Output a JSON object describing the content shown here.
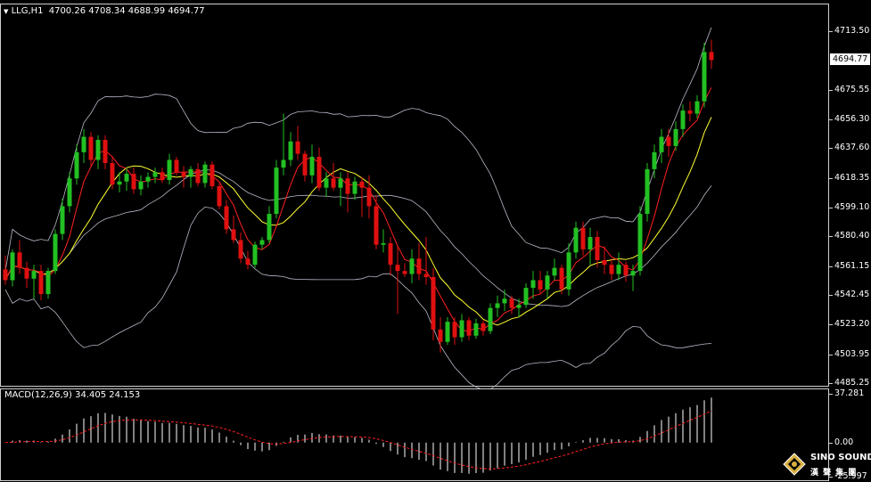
{
  "chart_header": {
    "symbol_label": "LLG,H1",
    "ohlc_text": "4700.26 4708.34 4688.99 4694.77",
    "arrow_glyph": "▼"
  },
  "macd_header": {
    "label": "MACD(12,26,9) 34.405 24.153"
  },
  "price_axis": {
    "ticks": [
      "4713.50",
      "4694.77",
      "4675.55",
      "4656.30",
      "4637.60",
      "4618.35",
      "4599.10",
      "4580.40",
      "4561.15",
      "4542.45",
      "4523.20",
      "4503.95",
      "4485.25"
    ],
    "current_price": "4694.77"
  },
  "macd_axis": {
    "ticks": [
      "37.281",
      "0.00",
      "-25.997"
    ]
  },
  "logo": {
    "text_en": "SINO SOUND",
    "text_cn": "漢 聲 集 團"
  },
  "colors": {
    "background": "#000000",
    "bull_candle": "#22c022",
    "bear_candle": "#e01010",
    "bollinger": "#b8b8c8",
    "ma_fast": "#ff2020",
    "ma_slow": "#ffff30",
    "macd_hist": "#ffffff",
    "macd_signal": "#ff2020"
  },
  "chart_data": [
    {
      "type": "candlestick",
      "title": "LLG,H1",
      "ylim": [
        4485.25,
        4713.5
      ],
      "ohlc": [
        [
          4559,
          4568,
          4549,
          4552
        ],
        [
          4552,
          4572,
          4548,
          4570
        ],
        [
          4570,
          4578,
          4556,
          4560
        ],
        [
          4560,
          4564,
          4547,
          4553
        ],
        [
          4553,
          4562,
          4540,
          4558
        ],
        [
          4558,
          4562,
          4539,
          4543
        ],
        [
          4543,
          4560,
          4540,
          4558
        ],
        [
          4558,
          4585,
          4556,
          4582
        ],
        [
          4582,
          4605,
          4578,
          4600
        ],
        [
          4600,
          4622,
          4596,
          4618
        ],
        [
          4618,
          4640,
          4614,
          4635
        ],
        [
          4635,
          4650,
          4628,
          4645
        ],
        [
          4645,
          4648,
          4626,
          4630
        ],
        [
          4630,
          4646,
          4624,
          4643
        ],
        [
          4643,
          4646,
          4624,
          4628
        ],
        [
          4628,
          4632,
          4611,
          4614
        ],
        [
          4614,
          4622,
          4609,
          4616
        ],
        [
          4616,
          4625,
          4610,
          4621
        ],
        [
          4621,
          4625,
          4608,
          4611
        ],
        [
          4611,
          4620,
          4607,
          4616
        ],
        [
          4616,
          4622,
          4612,
          4619
        ],
        [
          4619,
          4625,
          4615,
          4622
        ],
        [
          4622,
          4625,
          4615,
          4617
        ],
        [
          4617,
          4634,
          4614,
          4630
        ],
        [
          4630,
          4632,
          4620,
          4622
        ],
        [
          4622,
          4626,
          4612,
          4619
        ],
        [
          4619,
          4626,
          4612,
          4624
        ],
        [
          4624,
          4628,
          4613,
          4615
        ],
        [
          4615,
          4629,
          4612,
          4627
        ],
        [
          4627,
          4629,
          4611,
          4613
        ],
        [
          4613,
          4615,
          4598,
          4600
        ],
        [
          4600,
          4604,
          4582,
          4585
        ],
        [
          4585,
          4594,
          4576,
          4578
        ],
        [
          4578,
          4583,
          4563,
          4566
        ],
        [
          4566,
          4571,
          4559,
          4562
        ],
        [
          4562,
          4577,
          4560,
          4575
        ],
        [
          4575,
          4580,
          4572,
          4578
        ],
        [
          4578,
          4600,
          4576,
          4595
        ],
        [
          4595,
          4630,
          4592,
          4625
        ],
        [
          4625,
          4660,
          4620,
          4630
        ],
        [
          4630,
          4648,
          4626,
          4642
        ],
        [
          4642,
          4652,
          4630,
          4634
        ],
        [
          4634,
          4636,
          4616,
          4620
        ],
        [
          4620,
          4640,
          4615,
          4632
        ],
        [
          4632,
          4638,
          4610,
          4612
        ],
        [
          4612,
          4622,
          4606,
          4618
        ],
        [
          4618,
          4628,
          4610,
          4612
        ],
        [
          4612,
          4622,
          4600,
          4618
        ],
        [
          4618,
          4622,
          4596,
          4608
        ],
        [
          4608,
          4619,
          4604,
          4616
        ],
        [
          4616,
          4619,
          4593,
          4612
        ],
        [
          4612,
          4620,
          4592,
          4600
        ],
        [
          4600,
          4607,
          4572,
          4575
        ],
        [
          4575,
          4585,
          4570,
          4576
        ],
        [
          4576,
          4580,
          4555,
          4562
        ],
        [
          4562,
          4575,
          4530,
          4558
        ],
        [
          4558,
          4563,
          4554,
          4556
        ],
        [
          4556,
          4572,
          4550,
          4566
        ],
        [
          4566,
          4576,
          4552,
          4556
        ],
        [
          4556,
          4580,
          4549,
          4554
        ],
        [
          4554,
          4560,
          4513,
          4520
        ],
        [
          4520,
          4528,
          4505,
          4512
        ],
        [
          4512,
          4528,
          4510,
          4525
        ],
        [
          4525,
          4528,
          4510,
          4515
        ],
        [
          4515,
          4530,
          4512,
          4526
        ],
        [
          4526,
          4528,
          4513,
          4516
        ],
        [
          4516,
          4527,
          4514,
          4524
        ],
        [
          4524,
          4526,
          4516,
          4519
        ],
        [
          4519,
          4537,
          4517,
          4534
        ],
        [
          4534,
          4542,
          4528,
          4537
        ],
        [
          4537,
          4546,
          4532,
          4540
        ],
        [
          4540,
          4542,
          4530,
          4534
        ],
        [
          4534,
          4540,
          4528,
          4536
        ],
        [
          4536,
          4550,
          4534,
          4547
        ],
        [
          4547,
          4558,
          4540,
          4552
        ],
        [
          4552,
          4558,
          4543,
          4546
        ],
        [
          4546,
          4558,
          4540,
          4555
        ],
        [
          4555,
          4566,
          4552,
          4560
        ],
        [
          4560,
          4562,
          4543,
          4546
        ],
        [
          4546,
          4576,
          4542,
          4570
        ],
        [
          4570,
          4590,
          4566,
          4586
        ],
        [
          4586,
          4590,
          4568,
          4572
        ],
        [
          4572,
          4586,
          4562,
          4580
        ],
        [
          4580,
          4584,
          4560,
          4565
        ],
        [
          4565,
          4574,
          4556,
          4562
        ],
        [
          4562,
          4566,
          4552,
          4556
        ],
        [
          4556,
          4570,
          4552,
          4562
        ],
        [
          4562,
          4564,
          4551,
          4555
        ],
        [
          4555,
          4562,
          4545,
          4558
        ],
        [
          4558,
          4600,
          4555,
          4595
        ],
        [
          4595,
          4628,
          4590,
          4624
        ],
        [
          4624,
          4640,
          4618,
          4635
        ],
        [
          4635,
          4650,
          4628,
          4645
        ],
        [
          4645,
          4650,
          4632,
          4639
        ],
        [
          4639,
          4655,
          4636,
          4650
        ],
        [
          4650,
          4666,
          4645,
          4662
        ],
        [
          4662,
          4668,
          4655,
          4660
        ],
        [
          4660,
          4672,
          4657,
          4668
        ],
        [
          4668,
          4706,
          4664,
          4700
        ],
        [
          4700,
          4708,
          4689,
          4694.77
        ]
      ]
    },
    {
      "type": "bar",
      "title": "MACD(12,26,9) 34.405 24.153",
      "ylim": [
        -25.997,
        37.281
      ],
      "macd_value": 34.405,
      "signal_value": 24.153
    }
  ]
}
